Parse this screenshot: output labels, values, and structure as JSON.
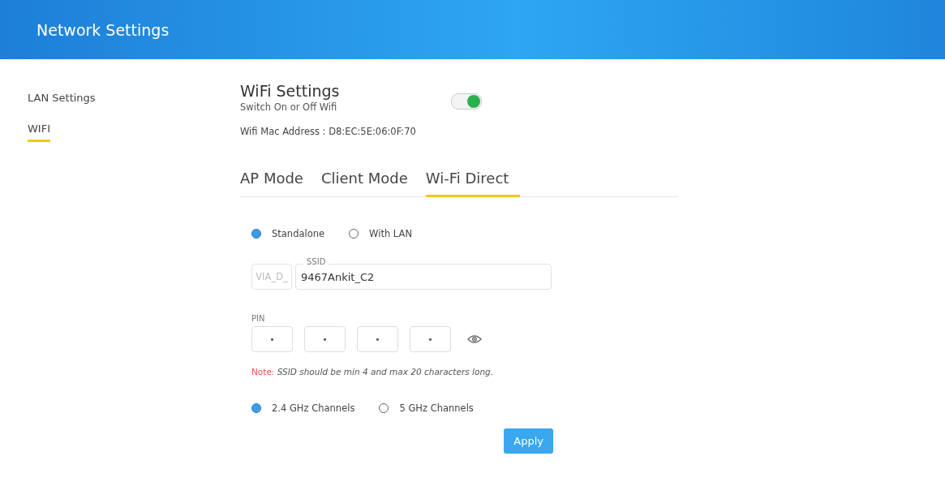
{
  "header": {
    "title": "Network Settings"
  },
  "sidebar": {
    "items": [
      {
        "label": "LAN Settings",
        "selected": false
      },
      {
        "label": "WIFI",
        "selected": true
      }
    ]
  },
  "wifi": {
    "title": "WiFi Settings",
    "subtitle": "Switch On or Off Wifi",
    "on": true,
    "mac_address": "Wifi Mac Address : D8:EC:5E:06:0F:70"
  },
  "tabs": [
    {
      "label": "AP Mode",
      "selected": false
    },
    {
      "label": "Client Mode",
      "selected": false
    },
    {
      "label": "Wi-Fi Direct",
      "selected": true
    }
  ],
  "mode_options": [
    {
      "label": "Standalone",
      "selected": true
    },
    {
      "label": "With LAN",
      "selected": false
    }
  ],
  "ssid": {
    "prefix": "VIA_D_",
    "label": "SSID",
    "value": "9467Ankit_C2"
  },
  "pin": {
    "label": "PIN",
    "digits": [
      "•",
      "•",
      "•",
      "•"
    ]
  },
  "note": {
    "label": "Note:",
    "text": "SSID should be min 4 and max 20 characters long."
  },
  "band_options": [
    {
      "label": "2.4 GHz Channels",
      "selected": true
    },
    {
      "label": "5 GHz Channels",
      "selected": false
    }
  ],
  "buttons": [
    {
      "label": "Apply"
    }
  ]
}
